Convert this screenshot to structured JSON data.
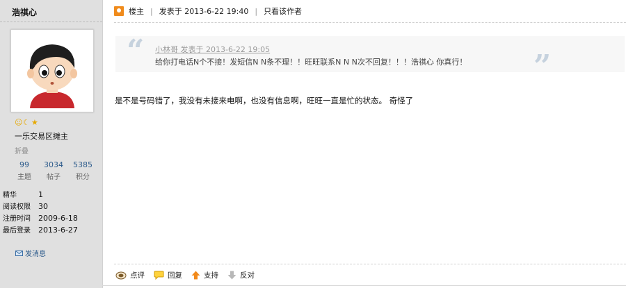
{
  "author": {
    "name": "浩祺心",
    "rank": "一乐交易区摊主",
    "fold_label": "折叠",
    "stats": [
      {
        "value": "99",
        "label": "主题"
      },
      {
        "value": "3034",
        "label": "帖子"
      },
      {
        "value": "5385",
        "label": "积分"
      }
    ],
    "info": [
      {
        "key": "精华",
        "value": "1"
      },
      {
        "key": "阅读权限",
        "value": "30"
      },
      {
        "key": "注册时间",
        "value": "2009-6-18"
      },
      {
        "key": "最后登录",
        "value": "2013-6-27"
      }
    ],
    "message_label": "发消息"
  },
  "post": {
    "owner_label": "楼主",
    "posted_at": "发表于 2013-6-22 19:40",
    "only_author": "只看该作者",
    "quote": {
      "meta": "小林哥 发表于 2013-6-22 19:05",
      "text": "给你打电话N个不接！发短信N N条不理！！旺旺联系N N N次不回复！！！浩祺心  你真行！"
    },
    "body": "是不是号码错了，我没有未接来电啊，也没有信息啊，旺旺一直是忙的状态。 奇怪了"
  },
  "actions": {
    "comment": "点评",
    "reply": "回复",
    "support": "支持",
    "oppose": "反对"
  }
}
